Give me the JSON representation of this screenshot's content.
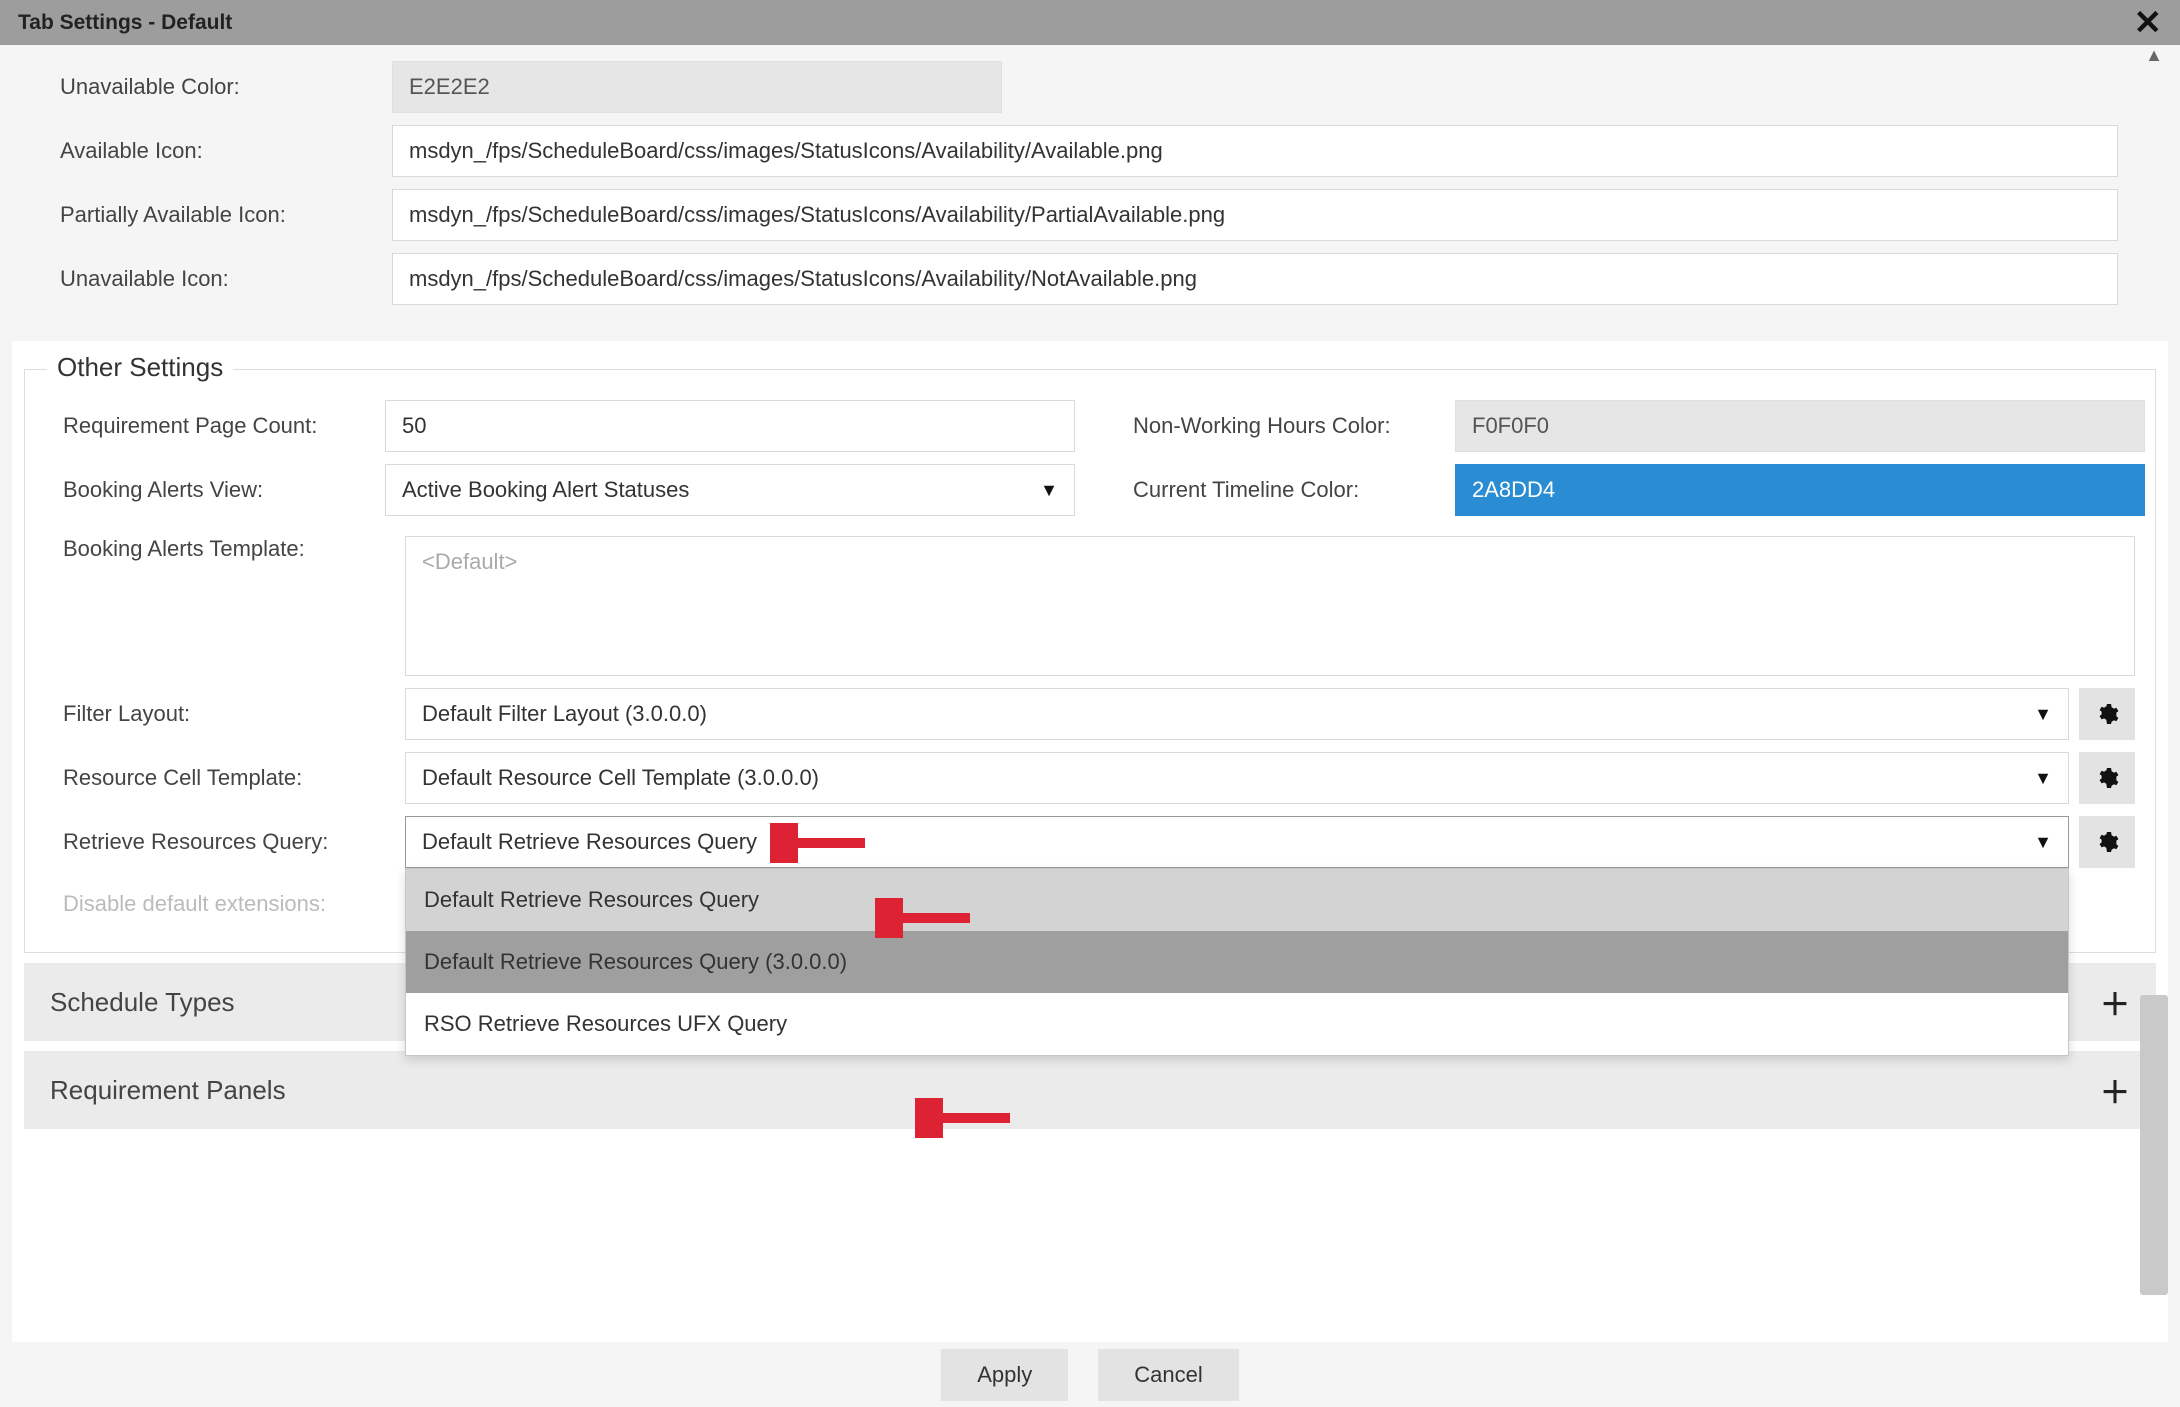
{
  "title": "Tab Settings - Default",
  "top": {
    "unavail_color_label": "Unavailable Color:",
    "unavail_color_value": "E2E2E2",
    "avail_icon_label": "Available Icon:",
    "avail_icon_value": "msdyn_/fps/ScheduleBoard/css/images/StatusIcons/Availability/Available.png",
    "partial_icon_label": "Partially Available Icon:",
    "partial_icon_value": "msdyn_/fps/ScheduleBoard/css/images/StatusIcons/Availability/PartialAvailable.png",
    "unavail_icon_label": "Unavailable Icon:",
    "unavail_icon_value": "msdyn_/fps/ScheduleBoard/css/images/StatusIcons/Availability/NotAvailable.png"
  },
  "other": {
    "legend": "Other Settings",
    "req_page_label": "Requirement Page Count:",
    "req_page_value": "50",
    "nonwork_label": "Non-Working Hours Color:",
    "nonwork_value": "F0F0F0",
    "alerts_view_label": "Booking Alerts View:",
    "alerts_view_value": "Active Booking Alert Statuses",
    "timeline_label": "Current Timeline Color:",
    "timeline_value": "2A8DD4",
    "alerts_tmpl_label": "Booking Alerts Template:",
    "alerts_tmpl_placeholder": "<Default>",
    "filter_layout_label": "Filter Layout:",
    "filter_layout_value": "Default Filter Layout (3.0.0.0)",
    "res_cell_label": "Resource Cell Template:",
    "res_cell_value": "Default Resource Cell Template (3.0.0.0)",
    "retrieve_label": "Retrieve Resources Query:",
    "retrieve_value": "Default Retrieve Resources Query",
    "retrieve_options": [
      "Default Retrieve Resources Query",
      "Default Retrieve Resources Query (3.0.0.0)",
      "RSO Retrieve Resources UFX Query"
    ],
    "disable_ext_label": "Disable default extensions:"
  },
  "acc": {
    "schedule_types": "Schedule Types",
    "req_panels": "Requirement Panels"
  },
  "footer": {
    "apply": "Apply",
    "cancel": "Cancel"
  }
}
